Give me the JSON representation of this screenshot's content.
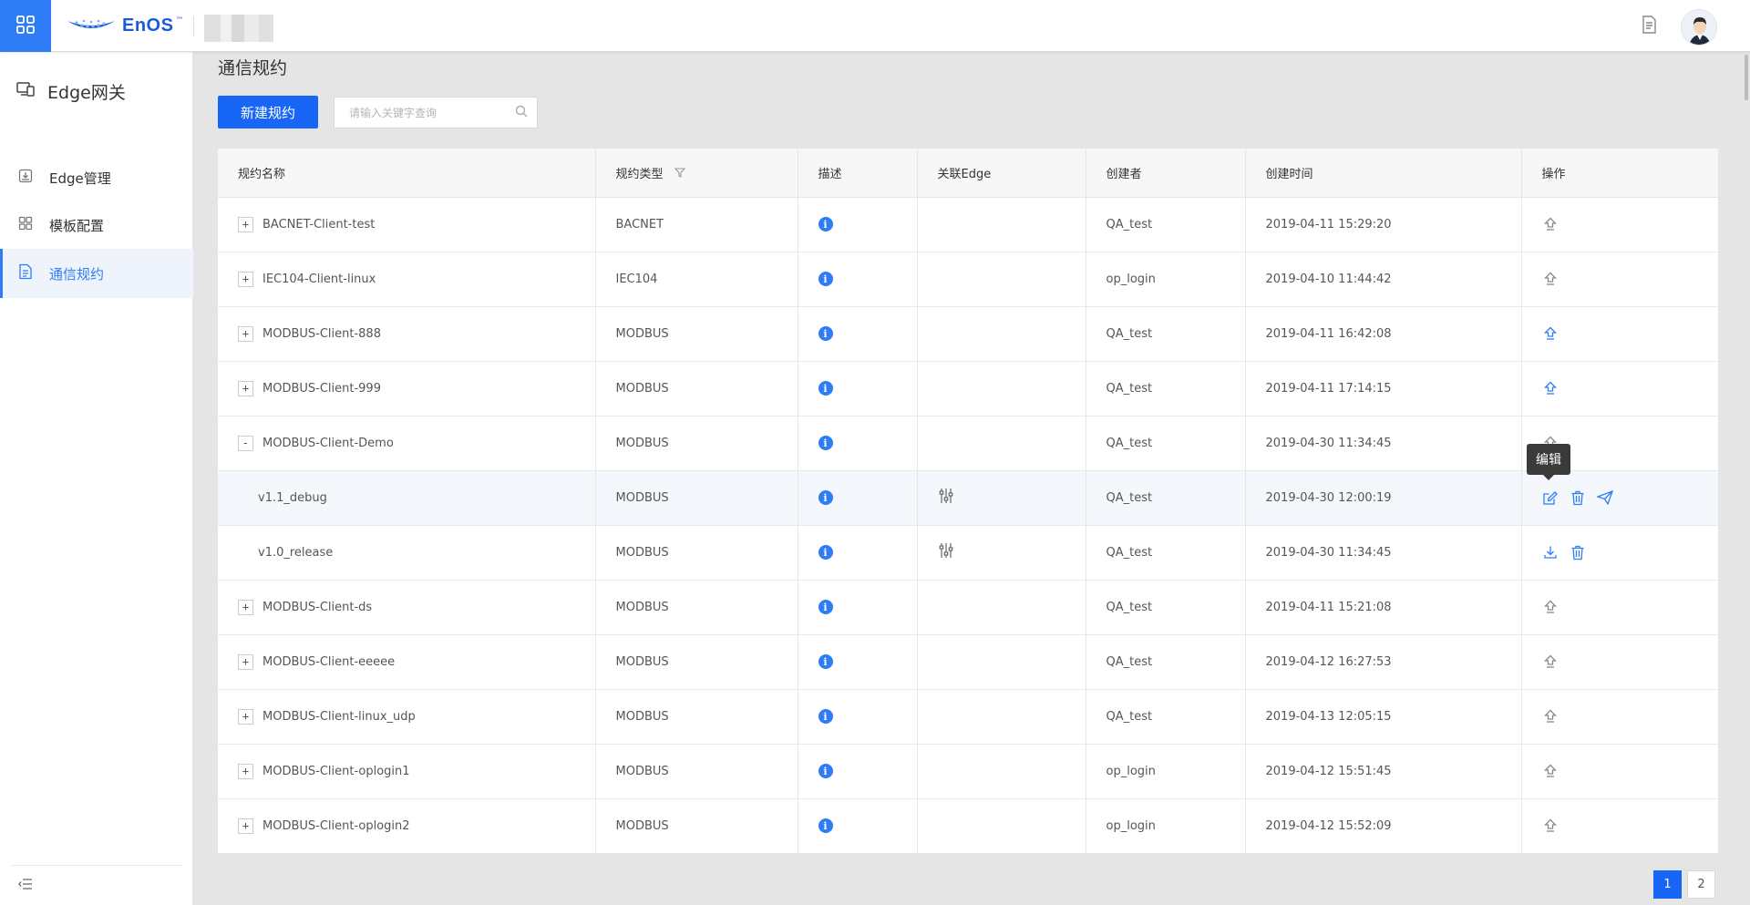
{
  "topbar": {
    "logo_text": "EnOS",
    "logo_tm": "™",
    "colors": {
      "accent": "#2f7df6",
      "primary_button": "#1766f5"
    }
  },
  "sidebar": {
    "title": "Edge网关",
    "items": [
      {
        "label": "Edge管理",
        "icon": "download-tray-icon",
        "active": false
      },
      {
        "label": "模板配置",
        "icon": "template-grid-icon",
        "active": false
      },
      {
        "label": "通信规约",
        "icon": "document-list-icon",
        "active": true
      }
    ]
  },
  "main": {
    "page_title": "通信规约",
    "new_button": "新建规约",
    "search_placeholder": "请输入关键字查询"
  },
  "table": {
    "headers": [
      "规约名称",
      "规约类型",
      "描述",
      "关联Edge",
      "创建者",
      "创建时间",
      "操作"
    ],
    "rows": [
      {
        "name": "BACNET-Client-test",
        "type": "BACNET",
        "creator": "QA_test",
        "created": "2019-04-11 15:29:20",
        "expander": "+",
        "level": 0,
        "linked_edge": false,
        "ops": [
          "upload-icon"
        ],
        "op_color": "gray"
      },
      {
        "name": "IEC104-Client-linux",
        "type": "IEC104",
        "creator": "op_login",
        "created": "2019-04-10 11:44:42",
        "expander": "+",
        "level": 0,
        "linked_edge": false,
        "ops": [
          "upload-icon"
        ],
        "op_color": "gray"
      },
      {
        "name": "MODBUS-Client-888",
        "type": "MODBUS",
        "creator": "QA_test",
        "created": "2019-04-11 16:42:08",
        "expander": "+",
        "level": 0,
        "linked_edge": false,
        "ops": [
          "upload-icon"
        ],
        "op_color": "blue"
      },
      {
        "name": "MODBUS-Client-999",
        "type": "MODBUS",
        "creator": "QA_test",
        "created": "2019-04-11 17:14:15",
        "expander": "+",
        "level": 0,
        "linked_edge": false,
        "ops": [
          "upload-icon"
        ],
        "op_color": "blue"
      },
      {
        "name": "MODBUS-Client-Demo",
        "type": "MODBUS",
        "creator": "QA_test",
        "created": "2019-04-30 11:34:45",
        "expander": "-",
        "level": 0,
        "linked_edge": false,
        "ops": [
          "upload-icon"
        ],
        "op_color": "gray"
      },
      {
        "name": "v1.1_debug",
        "type": "MODBUS",
        "creator": "QA_test",
        "created": "2019-04-30 12:00:19",
        "expander": "",
        "level": 1,
        "linked_edge": true,
        "ops": [
          "edit-icon",
          "delete-icon",
          "publish-icon"
        ],
        "op_color": "blue",
        "highlight": true
      },
      {
        "name": "v1.0_release",
        "type": "MODBUS",
        "creator": "QA_test",
        "created": "2019-04-30 11:34:45",
        "expander": "",
        "level": 1,
        "linked_edge": true,
        "ops": [
          "download-icon",
          "delete-icon"
        ],
        "op_color": "blue"
      },
      {
        "name": "MODBUS-Client-ds",
        "type": "MODBUS",
        "creator": "QA_test",
        "created": "2019-04-11 15:21:08",
        "expander": "+",
        "level": 0,
        "linked_edge": false,
        "ops": [
          "upload-icon"
        ],
        "op_color": "gray"
      },
      {
        "name": "MODBUS-Client-eeeee",
        "type": "MODBUS",
        "creator": "QA_test",
        "created": "2019-04-12 16:27:53",
        "expander": "+",
        "level": 0,
        "linked_edge": false,
        "ops": [
          "upload-icon"
        ],
        "op_color": "gray"
      },
      {
        "name": "MODBUS-Client-linux_udp",
        "type": "MODBUS",
        "creator": "QA_test",
        "created": "2019-04-13 12:05:15",
        "expander": "+",
        "level": 0,
        "linked_edge": false,
        "ops": [
          "upload-icon"
        ],
        "op_color": "gray"
      },
      {
        "name": "MODBUS-Client-oplogin1",
        "type": "MODBUS",
        "creator": "op_login",
        "created": "2019-04-12 15:51:45",
        "expander": "+",
        "level": 0,
        "linked_edge": false,
        "ops": [
          "upload-icon"
        ],
        "op_color": "gray"
      },
      {
        "name": "MODBUS-Client-oplogin2",
        "type": "MODBUS",
        "creator": "op_login",
        "created": "2019-04-12 15:52:09",
        "expander": "+",
        "level": 0,
        "linked_edge": false,
        "ops": [
          "upload-icon"
        ],
        "op_color": "gray"
      }
    ]
  },
  "tooltip": {
    "text": "编辑"
  },
  "pagination": {
    "pages": [
      "1",
      "2"
    ],
    "current": "1"
  }
}
